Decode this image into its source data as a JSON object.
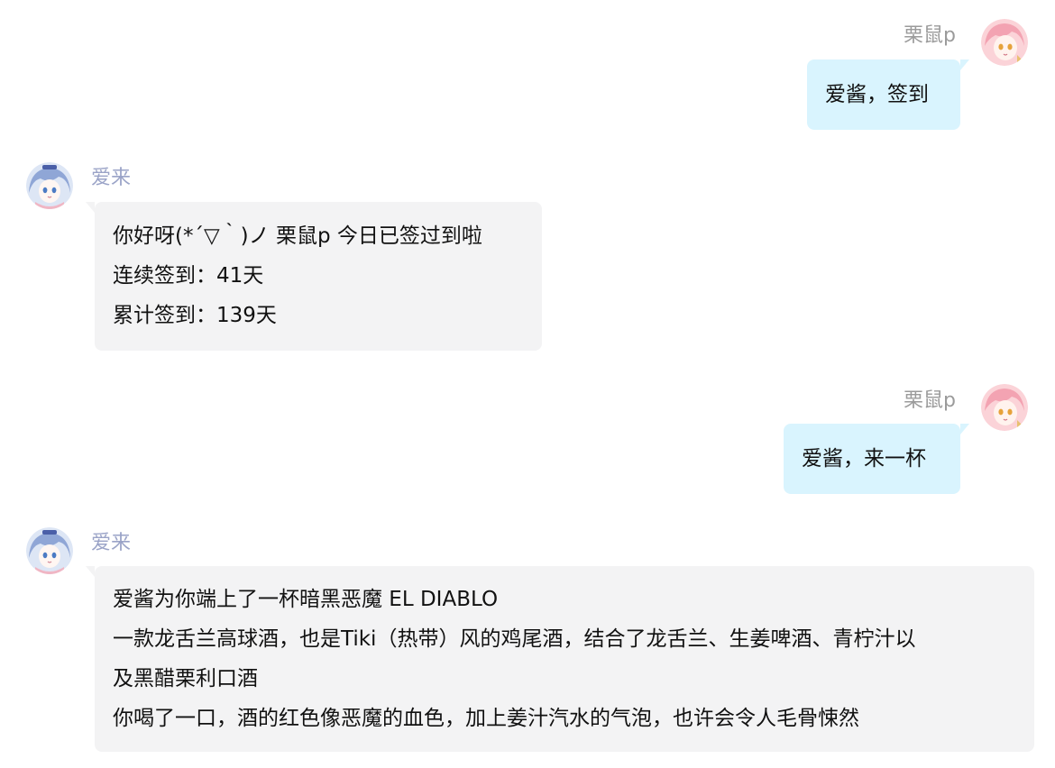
{
  "colors": {
    "user_name": "#9b9b9b",
    "bot_name": "#9aa3c7",
    "user_bubble": "#d9f4fe",
    "bot_bubble": "#f3f3f4",
    "text": "#111111"
  },
  "users": {
    "user": {
      "name": "栗鼠p",
      "avatar_icon": "pink-hair-anime-girl-avatar-icon"
    },
    "bot": {
      "name": "爱来",
      "avatar_icon": "blue-hair-anime-girl-avatar-icon"
    }
  },
  "messages": [
    {
      "sender": "user",
      "name": "栗鼠p",
      "lines": [
        "爱酱，签到"
      ]
    },
    {
      "sender": "bot",
      "name": "爱来",
      "lines": [
        "你好呀(*´▽｀)ノ 栗鼠p 今日已签过到啦",
        "连续签到：41天",
        "累计签到：139天"
      ]
    },
    {
      "sender": "user",
      "name": "栗鼠p",
      "lines": [
        "爱酱，来一杯"
      ]
    },
    {
      "sender": "bot",
      "name": "爱来",
      "lines": [
        "爱酱为你端上了一杯暗黑恶魔 EL DIABLO",
        "一款龙舌兰高球酒，也是Tiki（热带）风的鸡尾酒，结合了龙舌兰、生姜啤酒、青柠汁以",
        "及黑醋栗利口酒",
        "你喝了一口，酒的红色像恶魔的血色，加上姜汁汽水的气泡，也许会令人毛骨悚然"
      ]
    }
  ]
}
